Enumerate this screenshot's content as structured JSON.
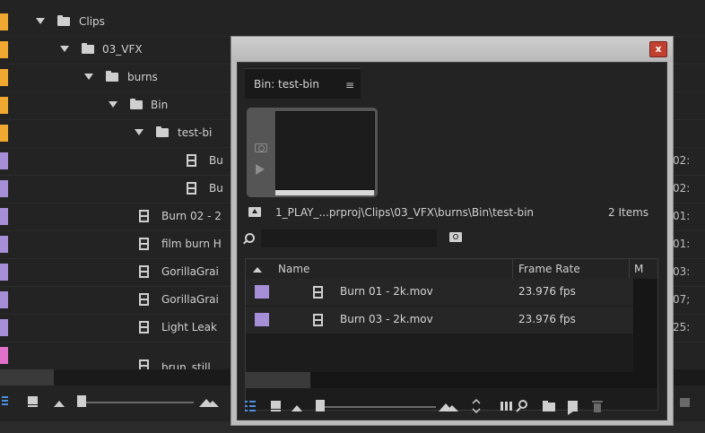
{
  "window": {
    "tab_label": "Bin: test-bin",
    "tab_menu_glyph": "≡",
    "close_glyph": "x",
    "path": "1_PLAY_...prproj\\Clips\\03_VFX\\burns\\Bin\\test-bin",
    "items_count": "2 Items",
    "search_value": "",
    "columns": {
      "name": "Name",
      "frame_rate": "Frame Rate",
      "m": "M"
    },
    "rows": [
      {
        "name": "Burn 01 - 2k.mov",
        "frame_rate": "23.976 fps",
        "label_color": "#a78fd8"
      },
      {
        "name": "Burn 03 - 2k.mov",
        "frame_rate": "23.976 fps",
        "label_color": "#a78fd8"
      }
    ]
  },
  "background_project": {
    "rows": [
      {
        "label": "Clips",
        "color": "#f0a830",
        "kind": "folder",
        "tc": ""
      },
      {
        "label": "03_VFX",
        "color": "#f0a830",
        "kind": "folder",
        "tc": ""
      },
      {
        "label": "burns",
        "color": "#f0a830",
        "kind": "folder",
        "tc": ""
      },
      {
        "label": "Bin",
        "color": "#f0a830",
        "kind": "folder",
        "tc": ""
      },
      {
        "label": "test-bi",
        "color": "#f0a830",
        "kind": "folder",
        "tc": ""
      },
      {
        "label": "Bu",
        "color": "#a78fd8",
        "kind": "clip",
        "tc": "02:"
      },
      {
        "label": "Bu",
        "color": "#a78fd8",
        "kind": "clip",
        "tc": "02:"
      },
      {
        "label": "Burn 02 - 2",
        "color": "#a78fd8",
        "kind": "clip",
        "tc": "01:"
      },
      {
        "label": "film burn H",
        "color": "#a78fd8",
        "kind": "clip",
        "tc": "01:"
      },
      {
        "label": "GorillaGrai",
        "color": "#a78fd8",
        "kind": "clip",
        "tc": "03:"
      },
      {
        "label": "GorillaGrai",
        "color": "#a78fd8",
        "kind": "clip",
        "tc": "07;"
      },
      {
        "label": "Light Leak",
        "color": "#a78fd8",
        "kind": "clip",
        "tc": "25:"
      },
      {
        "label": "brun_still",
        "color": "#e070c8",
        "kind": "still",
        "tc": ""
      }
    ]
  },
  "icons": {
    "window_toolbar": [
      "list-view-icon",
      "icon-view-icon",
      "zoom-out-icon",
      "zoom-slider",
      "zoom-in-icon",
      "sort-icon",
      "automate-to-sequence-icon",
      "find-icon",
      "new-bin-icon",
      "new-item-icon",
      "clear-icon"
    ]
  },
  "colors": {
    "panel_bg": "#232323",
    "accent": "#4a8fe0"
  }
}
